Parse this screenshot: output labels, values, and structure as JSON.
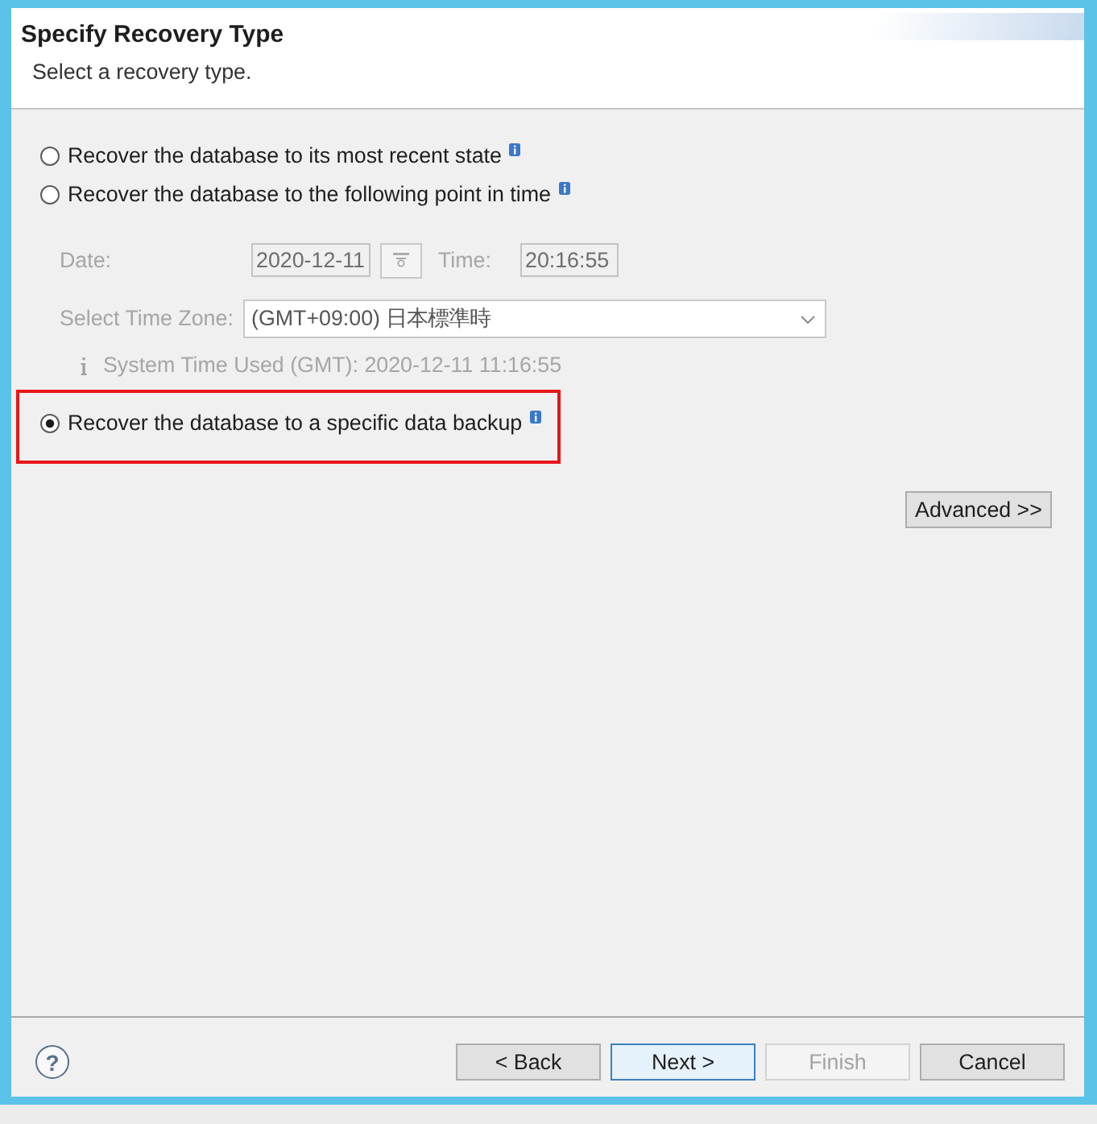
{
  "wizard": {
    "title": "Specify Recovery Type",
    "subtitle": "Select a recovery type."
  },
  "options": [
    {
      "label": "Recover the database to its most recent state",
      "selected": false,
      "highlighted": false
    },
    {
      "label": "Recover the database to the following point in time",
      "selected": false,
      "highlighted": false,
      "details": {
        "disabled": true,
        "date_label": "Date:",
        "date": "2020-12-11",
        "time_label": "Time:",
        "time": "20:16:55",
        "timezone_label": "Select Time Zone:",
        "timezone": "(GMT+09:00) 日本標準時",
        "note": "System Time Used (GMT): 2020-12-11 11:16:55"
      }
    },
    {
      "label": "Recover the database to a specific data backup",
      "selected": true,
      "highlighted": true
    }
  ],
  "advanced_button": {
    "label": "Advanced >>"
  },
  "help_button": {
    "glyph": "?"
  },
  "buttons": [
    {
      "label": "< Back",
      "disabled": false,
      "focused": false
    },
    {
      "label": "Next >",
      "disabled": false,
      "focused": true
    },
    {
      "label": "Finish",
      "disabled": true,
      "focused": false
    },
    {
      "label": "Cancel",
      "disabled": false,
      "focused": false
    }
  ]
}
